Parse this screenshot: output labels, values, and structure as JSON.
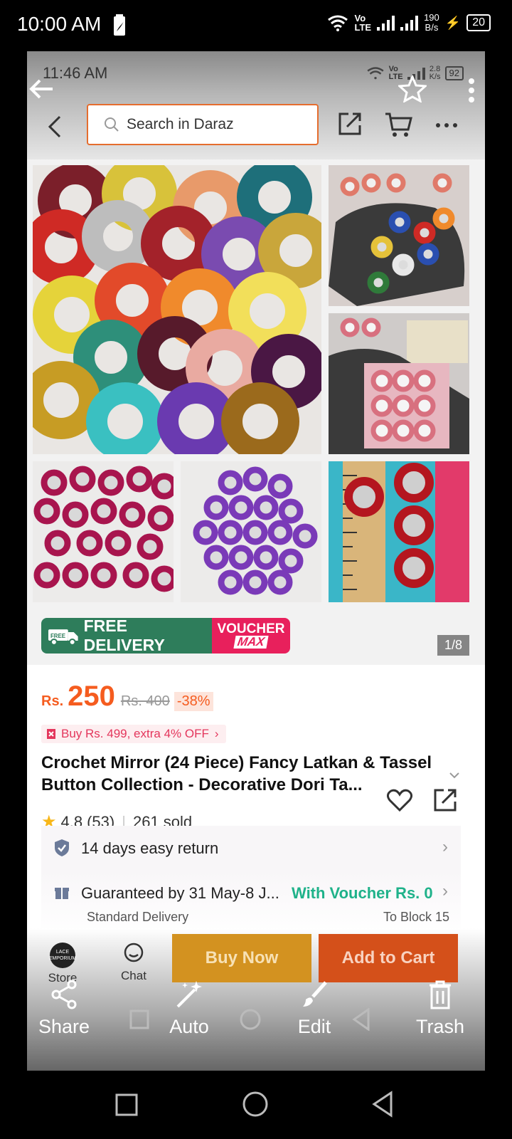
{
  "status_bar": {
    "time": "10:00 AM",
    "net1": "Vo",
    "net2": "LTE",
    "speed_value": "190",
    "speed_unit": "B/s",
    "battery": "20"
  },
  "inner_status": {
    "time": "11:46 AM",
    "net1": "Vo",
    "net2": "LTE",
    "speed_value": "2.8",
    "speed_unit": "K/s",
    "battery": "92"
  },
  "search": {
    "placeholder": "Search in Daraz"
  },
  "gallery": {
    "counter": "1/8"
  },
  "banner": {
    "delivery": "FREE DELIVERY",
    "free_tag": "FREE",
    "voucher_line1": "VOUCHER",
    "voucher_line2": "MAX"
  },
  "price": {
    "currency": "Rs.",
    "current": "250",
    "original": "Rs. 400",
    "discount": "-38%"
  },
  "promo": {
    "text": "Buy Rs. 499, extra 4% OFF"
  },
  "product": {
    "title": "Crochet Mirror (24 Piece) Fancy Latkan & Tassel Button Collection - Decorative Dori Ta..."
  },
  "rating": {
    "score": "4.8",
    "count": "(53)",
    "sold": "261 sold"
  },
  "services": {
    "return": "14 days easy return",
    "delivery": "Guaranteed by 31 May-8 J...",
    "voucher": "With Voucher Rs. 0",
    "delivery_type": "Standard Delivery",
    "destination": "To Block 15"
  },
  "bottom": {
    "store_label": "Store",
    "store_logo": "LACE EMPORIUM",
    "chat_label": "Chat",
    "buy_now": "Buy Now",
    "add_to_cart": "Add to Cart"
  },
  "editor": {
    "share": "Share",
    "auto": "Auto",
    "edit": "Edit",
    "trash": "Trash"
  },
  "colors": {
    "accent": "#f55c1f",
    "buy_now": "#f4a324",
    "add_to_cart": "#f55c1f",
    "voucher_green": "#1fb28a",
    "delivery_green": "#2e7d5b",
    "voucher_pink": "#e8205c"
  },
  "icons": [
    "back-arrow-icon",
    "star-icon",
    "more-vertical-icon",
    "chevron-left-icon",
    "search-icon",
    "share-icon",
    "cart-icon",
    "more-horizontal-icon",
    "heart-icon",
    "shield-icon",
    "gift-icon",
    "chevron-right-icon",
    "chat-icon",
    "wand-icon",
    "brush-icon",
    "trash-icon"
  ]
}
